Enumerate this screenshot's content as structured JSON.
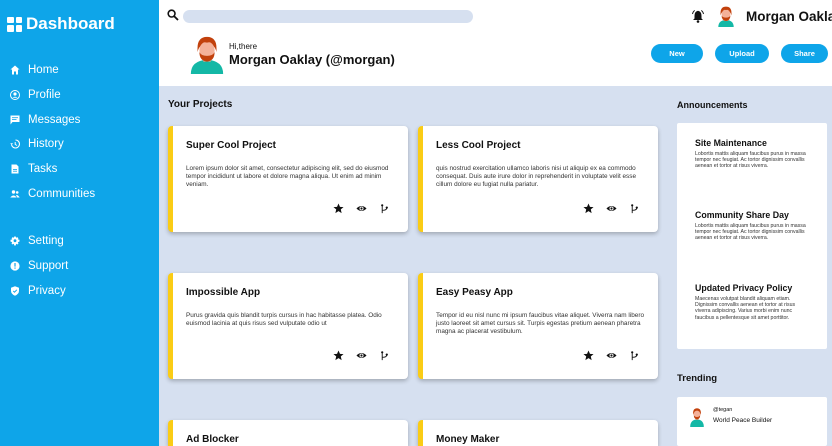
{
  "sidebar": {
    "brand": "Dashboard",
    "items": [
      {
        "label": "Home",
        "icon": "home-icon"
      },
      {
        "label": "Profile",
        "icon": "profile-icon"
      },
      {
        "label": "Messages",
        "icon": "messages-icon"
      },
      {
        "label": "History",
        "icon": "history-icon"
      },
      {
        "label": "Tasks",
        "icon": "tasks-icon"
      },
      {
        "label": "Communities",
        "icon": "communities-icon"
      }
    ],
    "secondary": [
      {
        "label": "Setting",
        "icon": "gear-icon"
      },
      {
        "label": "Support",
        "icon": "support-icon"
      },
      {
        "label": "Privacy",
        "icon": "shield-icon"
      }
    ]
  },
  "header": {
    "search_placeholder": "",
    "user_name": "Morgan Oaklay",
    "greeting": "Hi,there",
    "display_name": "Morgan Oaklay (@morgan)",
    "buttons": {
      "new": "New",
      "upload": "Upload",
      "share": "Share"
    }
  },
  "projects": {
    "title": "Your Projects",
    "cards": [
      {
        "title": "Super Cool Project",
        "description": "Lorem ipsum dolor sit amet, consectetur adipiscing elit, sed do eiusmod tempor incididunt ut labore et dolore magna aliqua. Ut enim ad minim veniam."
      },
      {
        "title": "Less Cool Project",
        "description": "quis nostrud exercitation ullamco laboris nisi ut aliquip ex ea commodo consequat. Duis aute irure dolor in reprehenderit in voluptate velit esse cillum dolore eu fugiat nulla pariatur."
      },
      {
        "title": "Impossible App",
        "description": "Purus gravida quis blandit turpis cursus in hac habitasse platea. Odio euismod lacinia at quis risus sed vulputate odio ut"
      },
      {
        "title": "Easy Peasy App",
        "description": "Tempor id eu nisl nunc mi ipsum faucibus vitae aliquet. Viverra nam libero justo laoreet sit amet cursus sit. Turpis egestas pretium aenean pharetra magna ac placerat vestibulum."
      },
      {
        "title": "Ad Blocker",
        "description": ""
      },
      {
        "title": "Money Maker",
        "description": ""
      }
    ]
  },
  "announcements": {
    "title": "Announcements",
    "items": [
      {
        "title": "Site Maintenance",
        "text": "Lobortis mattis aliquam faucibus purus in massa tempor nec feugiat. Ac tortor dignissim convallis aenean et tortor at risus viverra."
      },
      {
        "title": "Community Share Day",
        "text": "Lobortis mattis aliquam faucibus purus in massa tempor nec feugiat. Ac tortor dignissim convallis aenean et tortor at risus viverra."
      },
      {
        "title": "Updated Privacy Policy",
        "text": "Maecenas volutpat blandit aliquam etiam. Dignissim convallis aenean et tortor at risus viverra adipiscing. Varius morbi enim nunc faucibus a pellentesque sit amet porttitor."
      }
    ]
  },
  "trending": {
    "title": "Trending",
    "items": [
      {
        "handle": "@tegan",
        "title": "World Peace Builder"
      }
    ]
  },
  "colors": {
    "accent": "#0ea5e9",
    "card_stripe": "#facc15",
    "background": "#d6e0f0"
  }
}
